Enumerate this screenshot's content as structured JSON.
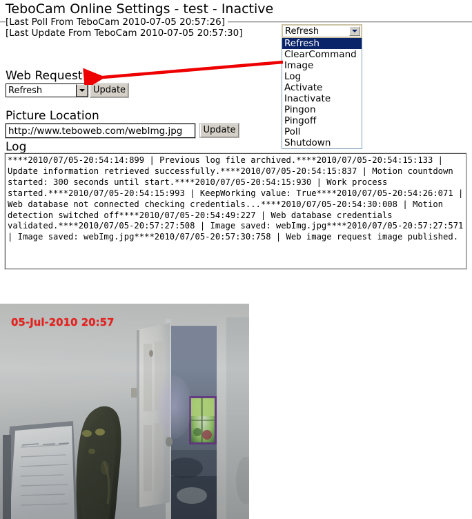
{
  "header": {
    "title": "TeboCam Online Settings - test - Inactive",
    "last_poll": "[Last Poll From TeboCam 2010-07-05 20:57:26]",
    "last_update": "[Last Update From TeboCam 2010-07-05 20:57:30]"
  },
  "command_dropdown": {
    "selected": "Refresh",
    "options": [
      "Refresh",
      "ClearCommand",
      "Image",
      "Log",
      "Activate",
      "Inactivate",
      "Pingon",
      "Pingoff",
      "Poll",
      "Shutdown"
    ],
    "highlight_color": "#0a246a"
  },
  "web_request": {
    "heading": "Web Request",
    "selected": "Refresh",
    "options": [
      "Refresh",
      "ClearCommand",
      "Image",
      "Log",
      "Activate",
      "Inactivate",
      "Pingon",
      "Pingoff",
      "Poll",
      "Shutdown"
    ],
    "update_label": "Update"
  },
  "picture_location": {
    "heading": "Picture Location",
    "value": "http://www.teboweb.com/webImg.jpg",
    "placeholder": "",
    "update_label": "Update"
  },
  "log": {
    "heading": "Log",
    "text": "****2010/07/05-20:54:14:899 | Previous log file archived.****2010/07/05-20:54:15:133 | Update information retrieved successfully.****2010/07/05-20:54:15:837 | Motion countdown started: 300 seconds until start.****2010/07/05-20:54:15:930 | Work process started.****2010/07/05-20:54:15:993 | KeepWorking value: True****2010/07/05-20:54:26:071 | Web database not connected checking credentials...****2010/07/05-20:54:30:008 | Motion detection switched off****2010/07/05-20:54:49:227 | Web database credentials validated.****2010/07/05-20:57:27:508 | Image saved: webImg.jpg****2010/07/05-20:57:27:571 | Image saved: webImg.jpg****2010/07/05-20:57:30:758 | Web image request image published."
  },
  "annotation": {
    "arrow_color": "#ee0000",
    "points_from": "Image",
    "points_to": "Web Request"
  },
  "webcam": {
    "timestamp": "05-Jul-2010 20:57",
    "timestamp_color": "#e8201c",
    "alt": "webcam view of a room interior with whiteboard, dark chair, open white door and lit hallway window"
  }
}
